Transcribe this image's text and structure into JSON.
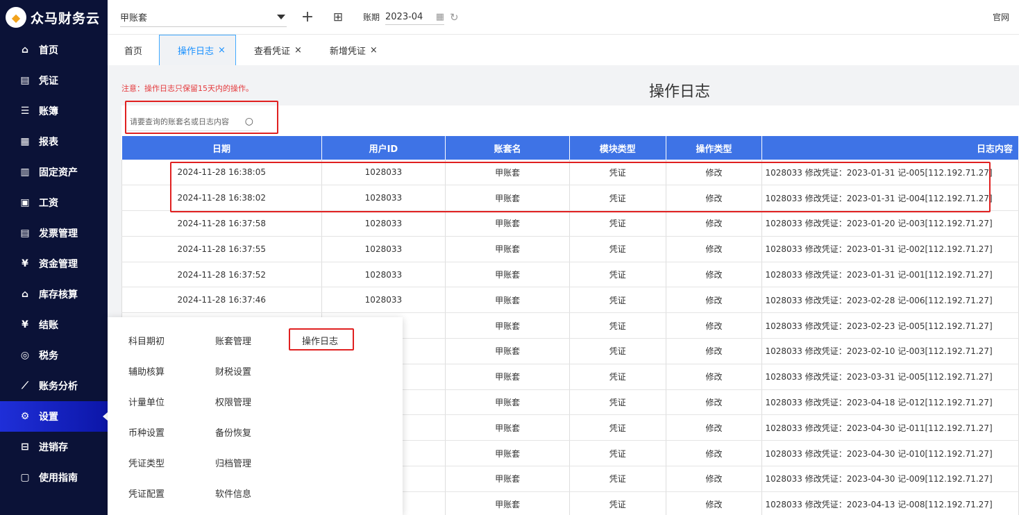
{
  "app": {
    "name": "众马财务云"
  },
  "sidebar": {
    "items": [
      {
        "label": "首页",
        "icon": "home-icon",
        "glyph": "⌂"
      },
      {
        "label": "凭证",
        "icon": "voucher-icon",
        "glyph": "▤"
      },
      {
        "label": "账簿",
        "icon": "ledger-icon",
        "glyph": "☰"
      },
      {
        "label": "报表",
        "icon": "report-icon",
        "glyph": "▦"
      },
      {
        "label": "固定资产",
        "icon": "asset-icon",
        "glyph": "▥"
      },
      {
        "label": "工资",
        "icon": "salary-icon",
        "glyph": "▣"
      },
      {
        "label": "发票管理",
        "icon": "invoice-icon",
        "glyph": "▤"
      },
      {
        "label": "资金管理",
        "icon": "fund-icon",
        "glyph": "¥"
      },
      {
        "label": "库存核算",
        "icon": "warehouse-icon",
        "glyph": "⌂"
      },
      {
        "label": "结账",
        "icon": "checkout-icon",
        "glyph": "¥"
      },
      {
        "label": "税务",
        "icon": "tax-icon",
        "glyph": "◎"
      },
      {
        "label": "账务分析",
        "icon": "analysis-icon",
        "glyph": "⟋"
      },
      {
        "label": "设置",
        "icon": "gear-icon",
        "glyph": "⚙"
      },
      {
        "label": "进销存",
        "icon": "inventory-icon",
        "glyph": "⊟"
      },
      {
        "label": "使用指南",
        "icon": "guide-icon",
        "glyph": "▢"
      }
    ],
    "active_index": 12
  },
  "topbar": {
    "account": "甲账套",
    "period_label": "账期",
    "period_value": "2023-04",
    "official_link": "官网"
  },
  "tabs": [
    {
      "label": "首页",
      "closable": false
    },
    {
      "label": "操作日志",
      "closable": true
    },
    {
      "label": "查看凭证",
      "closable": true
    },
    {
      "label": "新增凭证",
      "closable": true
    }
  ],
  "page": {
    "title": "操作日志",
    "notice": "注意：操作日志只保留15天内的操作。",
    "search_placeholder": "请要查询的账套名或日志内容"
  },
  "table": {
    "columns": [
      "日期",
      "用户ID",
      "账套名",
      "模块类型",
      "操作类型",
      "日志内容"
    ],
    "rows": [
      [
        "2024-11-28 16:38:05",
        "1028033",
        "甲账套",
        "凭证",
        "修改",
        "1028033 修改凭证：2023-01-31 记-005[112.192.71.27]"
      ],
      [
        "2024-11-28 16:38:02",
        "1028033",
        "甲账套",
        "凭证",
        "修改",
        "1028033 修改凭证：2023-01-31 记-004[112.192.71.27]"
      ],
      [
        "2024-11-28 16:37:58",
        "1028033",
        "甲账套",
        "凭证",
        "修改",
        "1028033 修改凭证：2023-01-20 记-003[112.192.71.27]"
      ],
      [
        "2024-11-28 16:37:55",
        "1028033",
        "甲账套",
        "凭证",
        "修改",
        "1028033 修改凭证：2023-01-31 记-002[112.192.71.27]"
      ],
      [
        "2024-11-28 16:37:52",
        "1028033",
        "甲账套",
        "凭证",
        "修改",
        "1028033 修改凭证：2023-01-31 记-001[112.192.71.27]"
      ],
      [
        "2024-11-28 16:37:46",
        "1028033",
        "甲账套",
        "凭证",
        "修改",
        "1028033 修改凭证：2023-02-28 记-006[112.192.71.27]"
      ],
      [
        "",
        "",
        "甲账套",
        "凭证",
        "修改",
        "1028033 修改凭证：2023-02-23 记-005[112.192.71.27]"
      ],
      [
        "",
        "",
        "甲账套",
        "凭证",
        "修改",
        "1028033 修改凭证：2023-02-10 记-003[112.192.71.27]"
      ],
      [
        "",
        "",
        "甲账套",
        "凭证",
        "修改",
        "1028033 修改凭证：2023-03-31 记-005[112.192.71.27]"
      ],
      [
        "",
        "",
        "甲账套",
        "凭证",
        "修改",
        "1028033 修改凭证：2023-04-18 记-012[112.192.71.27]"
      ],
      [
        "",
        "",
        "甲账套",
        "凭证",
        "修改",
        "1028033 修改凭证：2023-04-30 记-011[112.192.71.27]"
      ],
      [
        "",
        "",
        "甲账套",
        "凭证",
        "修改",
        "1028033 修改凭证：2023-04-30 记-010[112.192.71.27]"
      ],
      [
        "",
        "",
        "甲账套",
        "凭证",
        "修改",
        "1028033 修改凭证：2023-04-30 记-009[112.192.71.27]"
      ],
      [
        "",
        "",
        "甲账套",
        "凭证",
        "修改",
        "1028033 修改凭证：2023-04-13 记-008[112.192.71.27]"
      ]
    ]
  },
  "settings_menu": {
    "col1": [
      "科目期初",
      "辅助核算",
      "计量单位",
      "币种设置",
      "凭证类型",
      "凭证配置"
    ],
    "col2": [
      "账套管理",
      "财税设置",
      "权限管理",
      "备份恢复",
      "归档管理",
      "软件信息"
    ],
    "col3": [
      "操作日志"
    ]
  },
  "colors": {
    "sidebar_bg": "#0b1237",
    "header_blue": "#3e73e6",
    "highlight_red": "#e02020",
    "active_tab": "#1890ff"
  }
}
